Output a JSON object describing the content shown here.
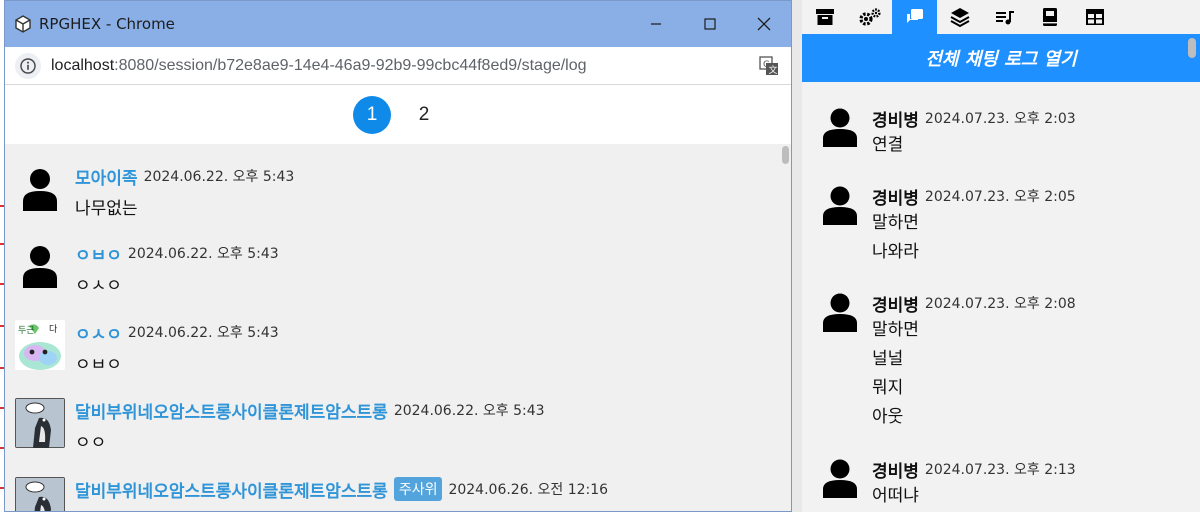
{
  "window": {
    "title": "RPGHEX - Chrome",
    "url_host": "localhost",
    "url_path": ":8080/session/b72e8ae9-14e4-46a9-92b9-99cbc44f8ed9/stage/log"
  },
  "pager": {
    "pages": [
      "1",
      "2"
    ],
    "active": "1"
  },
  "log": [
    {
      "name": "모아이족",
      "badge": "",
      "time": "2024.06.22. 오후 5:43",
      "text": "나무없는",
      "avatar": "person-silhouette"
    },
    {
      "name": "ㅇㅂㅇ",
      "badge": "",
      "time": "2024.06.22. 오후 5:43",
      "text": "ㅇㅅㅇ",
      "avatar": "person-silhouette"
    },
    {
      "name": "ㅇㅅㅇ",
      "badge": "",
      "time": "2024.06.22. 오후 5:43",
      "text": "ㅇㅂㅇ",
      "avatar": "cartoon-creature-image"
    },
    {
      "name": "달비부위네오암스트롱사이클론제트암스트롱",
      "badge": "",
      "time": "2024.06.22. 오후 5:43",
      "text": "ㅇㅇ",
      "avatar": "comic-penguin-image"
    },
    {
      "name": "달비부위네오암스트롱사이클론제트암스트롱",
      "badge": "주사위",
      "time": "2024.06.26. 오전 12:16",
      "text": "",
      "avatar": "comic-penguin-image"
    }
  ],
  "right_panel": {
    "tabs": [
      "archive-icon",
      "gears-icon",
      "chat-icon",
      "layers-icon",
      "music-list-icon",
      "book-icon",
      "table-icon"
    ],
    "active_tab": "chat-icon",
    "header": "전체 채팅 로그 열기",
    "messages": [
      {
        "name": "경비병",
        "time": "2024.07.23. 오후 2:03",
        "lines": [
          "연결"
        ]
      },
      {
        "name": "경비병",
        "time": "2024.07.23. 오후 2:05",
        "lines": [
          "말하면",
          "나와라"
        ]
      },
      {
        "name": "경비병",
        "time": "2024.07.23. 오후 2:08",
        "lines": [
          "말하면",
          "널널",
          "뭐지",
          "아웃"
        ]
      },
      {
        "name": "경비병",
        "time": "2024.07.23. 오후 2:13",
        "lines": [
          "어떠냐"
        ]
      }
    ]
  },
  "colors": {
    "accent": "#1e90ff",
    "name_blue": "#2f95d8",
    "titlebar": "#8aafe6"
  }
}
